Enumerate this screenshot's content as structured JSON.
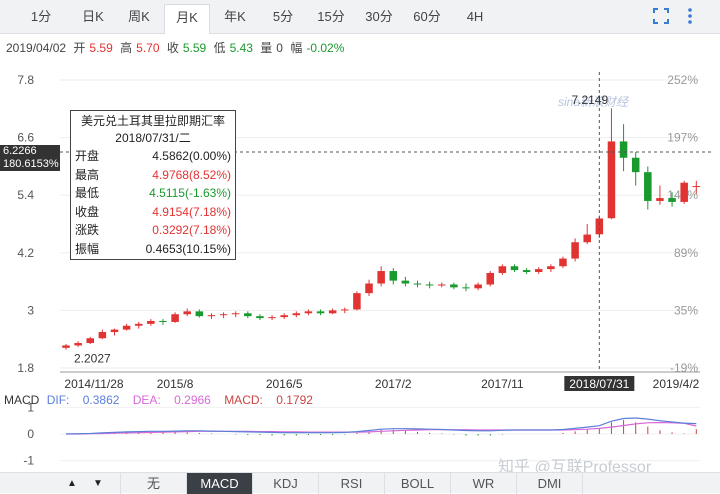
{
  "tabs": [
    {
      "label": "1分"
    },
    {
      "label": "日K"
    },
    {
      "label": "周K"
    },
    {
      "label": "月K"
    },
    {
      "label": "年K"
    },
    {
      "label": "5分"
    },
    {
      "label": "15分"
    },
    {
      "label": "30分"
    },
    {
      "label": "60分"
    },
    {
      "label": "4H"
    }
  ],
  "active_tab": "月K",
  "info": {
    "date": "2019/04/02",
    "open_label": "开",
    "open": "5.59",
    "high_label": "高",
    "high": "5.70",
    "close_label": "收",
    "close": "5.59",
    "low_label": "低",
    "low": "5.43",
    "vol_label": "量",
    "vol": "0",
    "amp_label": "幅",
    "amp": "-0.02%"
  },
  "price_marker": {
    "price": "6.2266",
    "pct": "180.6153%"
  },
  "tooltip": {
    "title": "美元兑土耳其里拉即期汇率",
    "date": "2018/07/31/二",
    "rows": [
      {
        "label": "开盘",
        "value": "4.5862(0.00%)",
        "color": "#222222"
      },
      {
        "label": "最高",
        "value": "4.9768(8.52%)",
        "color": "#e23333"
      },
      {
        "label": "最低",
        "value": "4.5115(-1.63%)",
        "color": "#1a9a2e"
      },
      {
        "label": "收盘",
        "value": "4.9154(7.18%)",
        "color": "#e23333"
      },
      {
        "label": "涨跌",
        "value": "0.3292(7.18%)",
        "color": "#e23333"
      },
      {
        "label": "振幅",
        "value": "0.4653(10.15%)",
        "color": "#222222"
      }
    ]
  },
  "chart_data": {
    "type": "candlestick",
    "y_ticks": [
      "7.8",
      "6.6",
      "5.4",
      "4.2",
      "3",
      "1.8"
    ],
    "y_tick_values": [
      7.8,
      6.6,
      5.4,
      4.2,
      3,
      1.8
    ],
    "pct_ticks": [
      "252%",
      "197%",
      "143%",
      "89%",
      "35%",
      "-19%"
    ],
    "x_ticks": [
      "2014/11/28",
      "2015/8",
      "2016/5",
      "2017/2",
      "2017/11",
      "2018/07/31",
      "2019/4/2"
    ],
    "x_tick_index": [
      0,
      9,
      18,
      27,
      36,
      44,
      52
    ],
    "annotations": [
      {
        "text": "7.2149",
        "value": 7.2149,
        "index": 45
      },
      {
        "text": "2.2027",
        "value": 2.2027,
        "index": 0
      }
    ],
    "crosshair_index": 44,
    "ohlc": [
      [
        2.22,
        2.3,
        2.18,
        2.27
      ],
      [
        2.27,
        2.36,
        2.24,
        2.32
      ],
      [
        2.32,
        2.45,
        2.3,
        2.42
      ],
      [
        2.42,
        2.6,
        2.4,
        2.55
      ],
      [
        2.55,
        2.62,
        2.48,
        2.6
      ],
      [
        2.6,
        2.72,
        2.58,
        2.68
      ],
      [
        2.68,
        2.76,
        2.62,
        2.72
      ],
      [
        2.72,
        2.82,
        2.68,
        2.78
      ],
      [
        2.78,
        2.82,
        2.7,
        2.76
      ],
      [
        2.76,
        2.96,
        2.74,
        2.92
      ],
      [
        2.92,
        3.04,
        2.88,
        2.98
      ],
      [
        2.98,
        3.02,
        2.85,
        2.88
      ],
      [
        2.88,
        2.94,
        2.82,
        2.9
      ],
      [
        2.9,
        2.96,
        2.84,
        2.92
      ],
      [
        2.92,
        2.98,
        2.86,
        2.94
      ],
      [
        2.94,
        2.98,
        2.84,
        2.88
      ],
      [
        2.88,
        2.92,
        2.8,
        2.84
      ],
      [
        2.84,
        2.9,
        2.8,
        2.86
      ],
      [
        2.86,
        2.94,
        2.82,
        2.9
      ],
      [
        2.9,
        2.98,
        2.86,
        2.94
      ],
      [
        2.94,
        3.02,
        2.9,
        2.98
      ],
      [
        2.98,
        3.02,
        2.9,
        2.94
      ],
      [
        2.94,
        3.04,
        2.92,
        3.0
      ],
      [
        3.0,
        3.06,
        2.94,
        3.02
      ],
      [
        3.02,
        3.4,
        3.0,
        3.36
      ],
      [
        3.36,
        3.64,
        3.3,
        3.56
      ],
      [
        3.56,
        3.92,
        3.5,
        3.82
      ],
      [
        3.82,
        3.88,
        3.54,
        3.62
      ],
      [
        3.62,
        3.7,
        3.5,
        3.56
      ],
      [
        3.56,
        3.62,
        3.48,
        3.54
      ],
      [
        3.54,
        3.6,
        3.46,
        3.52
      ],
      [
        3.52,
        3.58,
        3.48,
        3.54
      ],
      [
        3.54,
        3.58,
        3.44,
        3.48
      ],
      [
        3.48,
        3.56,
        3.4,
        3.46
      ],
      [
        3.46,
        3.58,
        3.42,
        3.54
      ],
      [
        3.54,
        3.82,
        3.5,
        3.78
      ],
      [
        3.78,
        3.96,
        3.74,
        3.92
      ],
      [
        3.92,
        3.96,
        3.8,
        3.84
      ],
      [
        3.84,
        3.88,
        3.76,
        3.8
      ],
      [
        3.8,
        3.9,
        3.76,
        3.86
      ],
      [
        3.86,
        3.96,
        3.8,
        3.92
      ],
      [
        3.92,
        4.12,
        3.88,
        4.08
      ],
      [
        4.08,
        4.5,
        4.02,
        4.42
      ],
      [
        4.42,
        4.8,
        4.38,
        4.58
      ],
      [
        4.586,
        4.977,
        4.512,
        4.915
      ],
      [
        4.92,
        7.21,
        4.9,
        6.52
      ],
      [
        6.52,
        6.88,
        5.9,
        6.18
      ],
      [
        6.18,
        6.3,
        5.6,
        5.88
      ],
      [
        5.88,
        6.0,
        5.1,
        5.28
      ],
      [
        5.28,
        5.6,
        5.2,
        5.34
      ],
      [
        5.34,
        5.46,
        5.16,
        5.26
      ],
      [
        5.26,
        5.7,
        5.22,
        5.66
      ],
      [
        5.59,
        5.7,
        5.43,
        5.59
      ]
    ],
    "macd": {
      "y_ticks": [
        "1",
        "0",
        "-1"
      ],
      "y_tick_values": [
        1,
        0,
        -1
      ],
      "dif_label": "DIF",
      "dif": "0.3862",
      "dea_label": "DEA",
      "dea": "0.2966",
      "macd_label": "MACD",
      "macd_value": "0.1792",
      "dif_series": [
        0.0,
        0.01,
        0.02,
        0.04,
        0.06,
        0.08,
        0.09,
        0.1,
        0.1,
        0.11,
        0.12,
        0.12,
        0.11,
        0.1,
        0.09,
        0.08,
        0.07,
        0.06,
        0.05,
        0.05,
        0.05,
        0.05,
        0.05,
        0.06,
        0.09,
        0.13,
        0.18,
        0.2,
        0.2,
        0.19,
        0.18,
        0.17,
        0.15,
        0.13,
        0.12,
        0.12,
        0.14,
        0.15,
        0.15,
        0.15,
        0.15,
        0.17,
        0.21,
        0.26,
        0.31,
        0.48,
        0.58,
        0.6,
        0.56,
        0.5,
        0.45,
        0.41,
        0.39
      ],
      "dea_series": [
        0.0,
        0.0,
        0.01,
        0.02,
        0.03,
        0.04,
        0.05,
        0.06,
        0.07,
        0.08,
        0.09,
        0.1,
        0.1,
        0.1,
        0.1,
        0.1,
        0.09,
        0.09,
        0.08,
        0.08,
        0.07,
        0.07,
        0.07,
        0.07,
        0.07,
        0.08,
        0.1,
        0.12,
        0.14,
        0.15,
        0.16,
        0.16,
        0.16,
        0.16,
        0.15,
        0.15,
        0.15,
        0.15,
        0.15,
        0.15,
        0.15,
        0.15,
        0.16,
        0.18,
        0.21,
        0.26,
        0.32,
        0.38,
        0.42,
        0.43,
        0.42,
        0.4,
        0.3
      ]
    }
  },
  "bottom_tabs": [
    {
      "label": "无"
    },
    {
      "label": "MACD"
    },
    {
      "label": "KDJ"
    },
    {
      "label": "RSI"
    },
    {
      "label": "BOLL"
    },
    {
      "label": "WR"
    },
    {
      "label": "DMI"
    }
  ],
  "active_bottom_tab": "MACD",
  "watermark": "知乎 @互联Professor",
  "logo_text": "sina新浪财经",
  "colors": {
    "up": "#e23333",
    "down": "#1a9a2e",
    "dif": "#5b7fd9",
    "dea": "#d967d9",
    "macd": "#c94444"
  }
}
